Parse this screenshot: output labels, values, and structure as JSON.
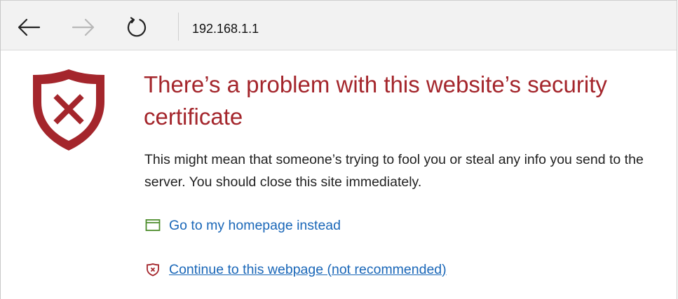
{
  "browser": {
    "address": "192.168.1.1",
    "icons": {
      "back": "back-arrow-icon",
      "forward": "forward-arrow-icon",
      "refresh": "refresh-icon"
    }
  },
  "error_page": {
    "title": "There’s a problem with this website’s security certificate",
    "message": "This might mean that someone’s trying to fool you or steal any info you send to the server. You should close this site immediately.",
    "home_link": "Go to my homepage instead",
    "continue_link": "Continue to this webpage (not recommended)"
  },
  "colors": {
    "title": "#a4262c",
    "link": "#1a67b8",
    "shield": "#a4262c",
    "home_icon": "#4c8c2b"
  }
}
